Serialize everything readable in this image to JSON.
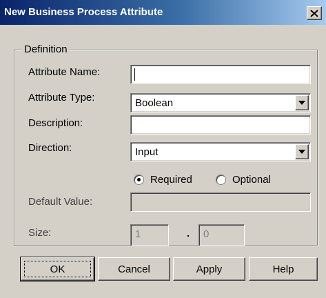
{
  "window": {
    "title": "New Business Process Attribute",
    "close_icon": "close-icon"
  },
  "group": {
    "legend": "Definition"
  },
  "fields": {
    "attribute_name": {
      "label": "Attribute Name:",
      "value": ""
    },
    "attribute_type": {
      "label": "Attribute Type:",
      "value": "Boolean"
    },
    "description": {
      "label": "Description:",
      "value": ""
    },
    "direction": {
      "label": "Direction:",
      "value": "Input"
    },
    "default_value": {
      "label": "Default Value:",
      "value": ""
    },
    "size": {
      "label": "Size:",
      "value1": "1",
      "value2": "0"
    }
  },
  "radios": {
    "required": {
      "label": "Required",
      "checked": true
    },
    "optional": {
      "label": "Optional",
      "checked": false
    }
  },
  "buttons": {
    "ok": "OK",
    "cancel": "Cancel",
    "apply": "Apply",
    "help": "Help"
  },
  "colors": {
    "title_start": "#0a246a",
    "title_end": "#a6caf0",
    "face": "#d4d0c8"
  }
}
